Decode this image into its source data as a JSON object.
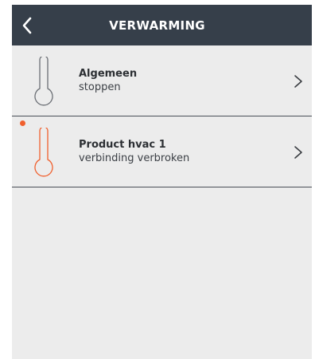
{
  "header": {
    "title": "VERWARMING"
  },
  "items": [
    {
      "name": "Algemeen",
      "status": "stoppen",
      "icon": "thermometer-icon",
      "icon_color": "#6b6f75",
      "alert": false
    },
    {
      "name": "Product hvac 1",
      "status": "verbinding verbroken",
      "icon": "thermometer-icon",
      "icon_color": "#f0602e",
      "alert": true
    }
  ],
  "colors": {
    "header_bg": "#363f4a",
    "alert": "#f0602e",
    "panel_bg": "#ececec"
  }
}
